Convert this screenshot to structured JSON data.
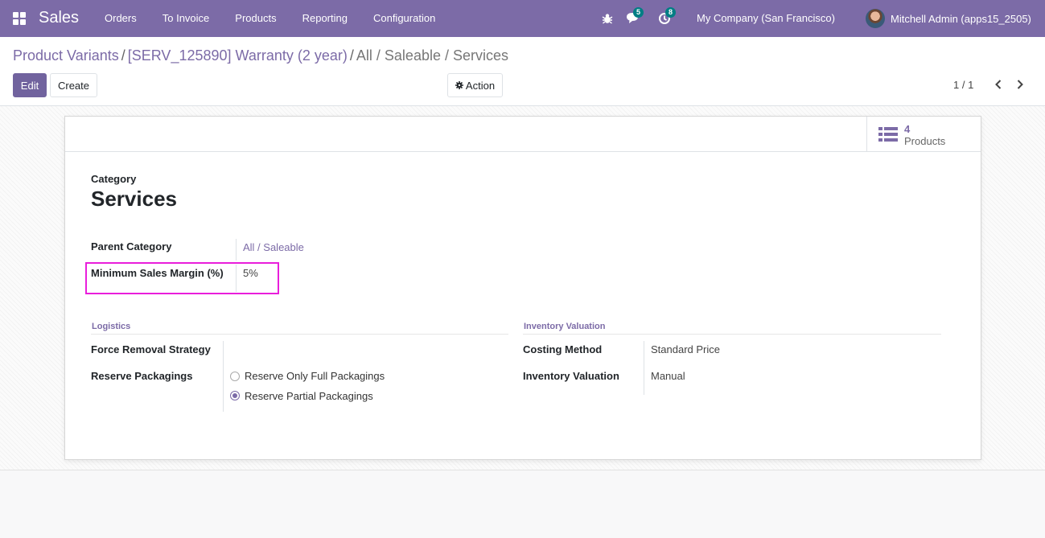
{
  "navbar": {
    "app_name": "Sales",
    "menu": [
      "Orders",
      "To Invoice",
      "Products",
      "Reporting",
      "Configuration"
    ],
    "messages_count": "5",
    "activities_count": "8",
    "company": "My Company (San Francisco)",
    "user": "Mitchell Admin (apps15_2505)",
    "icons": [
      "apps-grid-icon",
      "bug-icon",
      "chat-icon",
      "clock-icon",
      "user-avatar"
    ]
  },
  "breadcrumb": {
    "items": [
      "Product Variants",
      "[SERV_125890] Warranty (2 year)"
    ],
    "separator": "/",
    "active": "All / Saleable / Services"
  },
  "buttons": {
    "edit": "Edit",
    "create": "Create",
    "action": "Action"
  },
  "pager": {
    "value": "1 / 1"
  },
  "smart_button": {
    "count": "4",
    "label": "Products"
  },
  "form": {
    "category_label": "Category",
    "title": "Services",
    "parent_category_label": "Parent Category",
    "parent_category_value": "All / Saleable",
    "min_margin_label": "Minimum Sales Margin (%)",
    "min_margin_value": "5%",
    "logistics": {
      "title": "Logistics",
      "force_removal_label": "Force Removal Strategy",
      "reserve_packagings_label": "Reserve Packagings",
      "options": [
        "Reserve Only Full Packagings",
        "Reserve Partial Packagings"
      ],
      "selected": "Reserve Partial Packagings"
    },
    "inventory_valuation": {
      "title": "Inventory Valuation",
      "costing_method_label": "Costing Method",
      "costing_method_value": "Standard Price",
      "valuation_label": "Inventory Valuation",
      "valuation_value": "Manual"
    }
  },
  "colors": {
    "brand": "#7c6ba7",
    "primary_button": "#71639e",
    "badge": "#017e84",
    "highlight": "#e91edb"
  }
}
